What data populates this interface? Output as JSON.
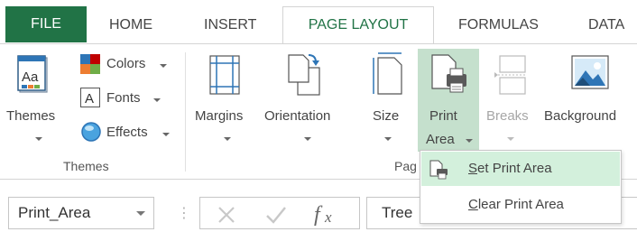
{
  "tabs": {
    "file": "FILE",
    "home": "HOME",
    "insert": "INSERT",
    "page_layout": "PAGE LAYOUT",
    "formulas": "FORMULAS",
    "data": "DATA"
  },
  "ribbon": {
    "themes_group": {
      "themes": "Themes",
      "colors": "Colors",
      "fonts": "Fonts",
      "effects": "Effects",
      "label": "Themes"
    },
    "page_setup_group": {
      "margins": "Margins",
      "orientation": "Orientation",
      "size": "Size",
      "print": "Print",
      "area": "Area",
      "breaks": "Breaks",
      "background": "Background",
      "label_partial": "Pag"
    }
  },
  "print_area_menu": {
    "set_prefix": "S",
    "set_rest": "et Print Area",
    "clear_prefix": "C",
    "clear_rest": "lear Print Area"
  },
  "formula_bar": {
    "name_box": "Print_Area",
    "cell_value": "Tree"
  },
  "colors": {
    "accent": "#217346",
    "highlight": "#c5e0cd",
    "menu_highlight": "#d3f0dc"
  },
  "icons": [
    "themes-icon",
    "colors-icon",
    "fonts-icon",
    "effects-icon",
    "margins-icon",
    "orientation-icon",
    "size-icon",
    "print-area-icon",
    "breaks-icon",
    "background-icon",
    "set-print-area-icon",
    "cancel-icon",
    "enter-icon",
    "function-icon"
  ]
}
